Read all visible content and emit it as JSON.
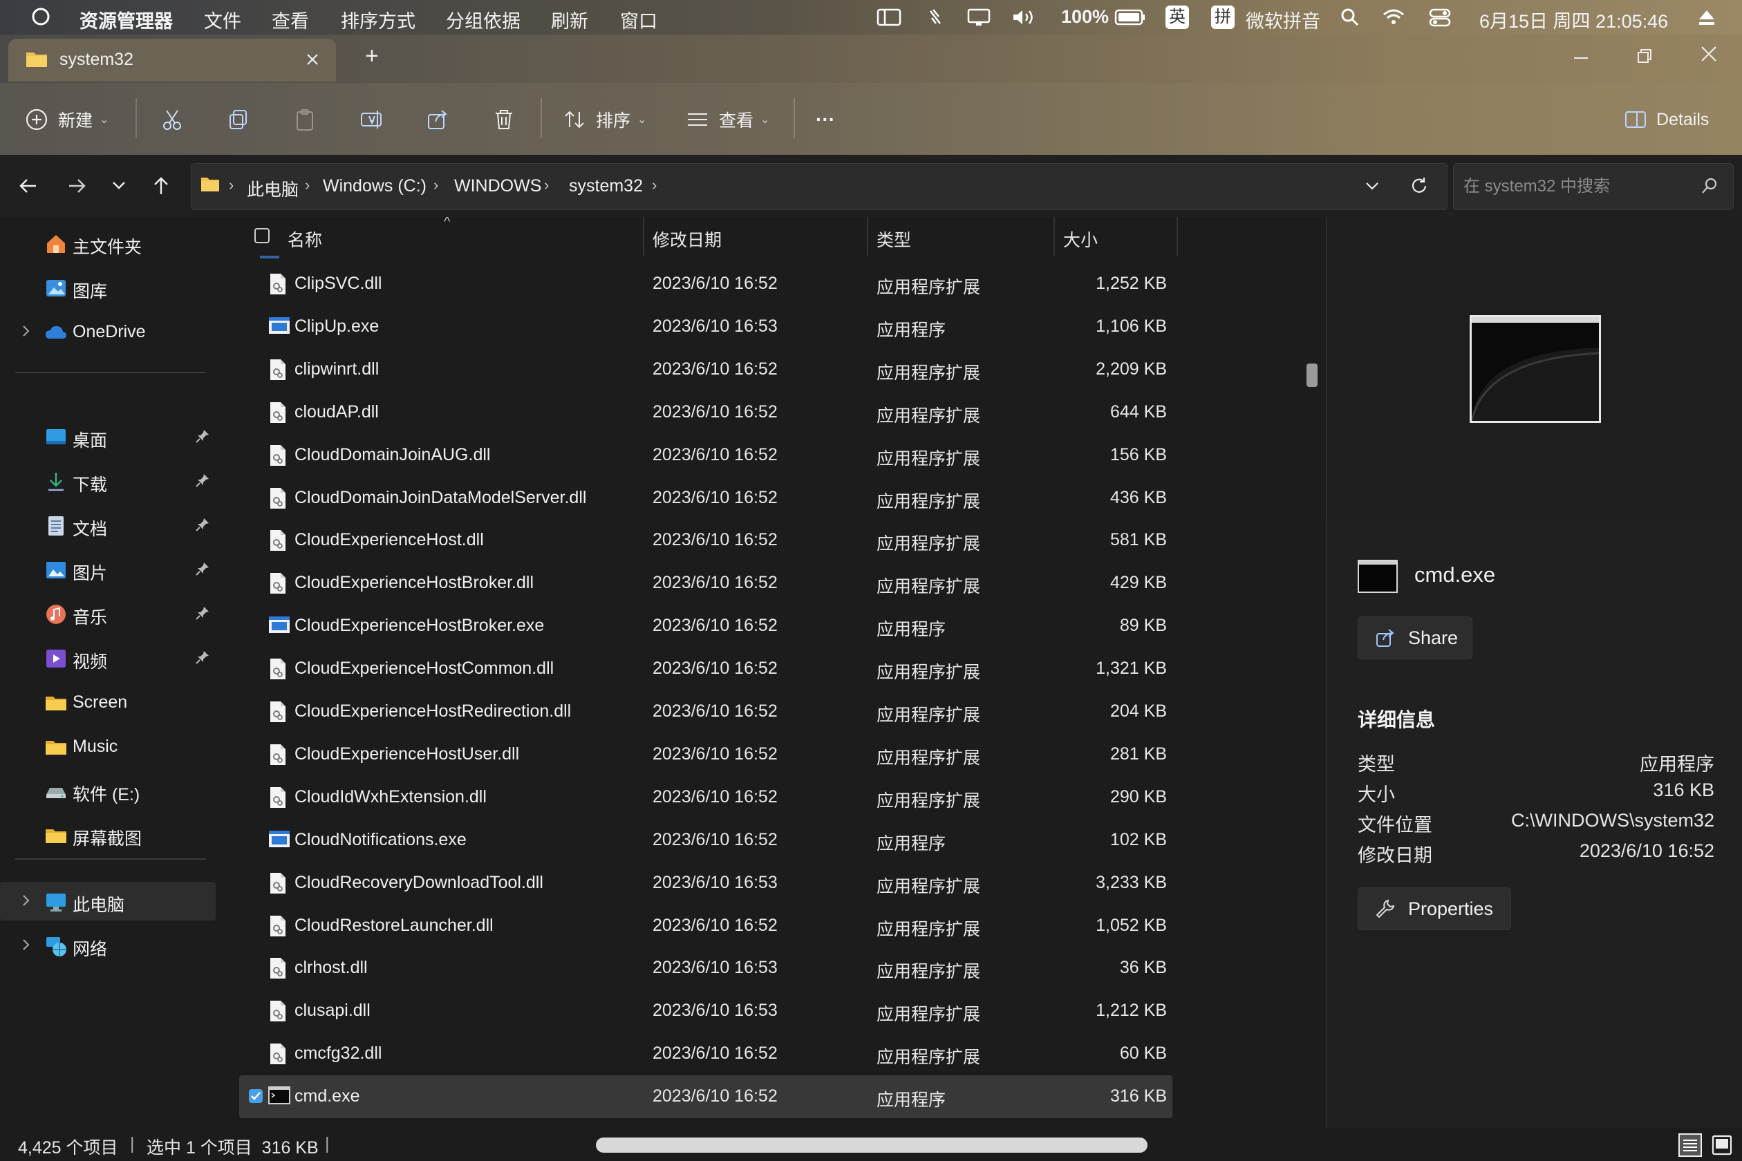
{
  "menubar": {
    "app_name": "资源管理器",
    "menus": [
      "文件",
      "查看",
      "排序方式",
      "分组依据",
      "刷新",
      "窗口"
    ],
    "battery": "100%",
    "ime_en": "英",
    "ime_pin": "拼",
    "ime_name": "微软拼音",
    "datetime": "6月15日 周四 21:05:46"
  },
  "tab": {
    "title": "system32",
    "new_tab": "+"
  },
  "toolbar": {
    "new_label": "新建",
    "sort_label": "排序",
    "view_label": "查看",
    "more_label": "···",
    "details_label": "Details"
  },
  "address": {
    "crumbs": [
      "此电脑",
      "Windows (C:)",
      "WINDOWS",
      "system32"
    ],
    "search_placeholder": "在 system32 中搜索"
  },
  "nav": {
    "home": "主文件夹",
    "gallery": "图库",
    "onedrive": "OneDrive",
    "quick": [
      {
        "label": "桌面",
        "icon": "desktop-icon"
      },
      {
        "label": "下载",
        "icon": "download-icon"
      },
      {
        "label": "文档",
        "icon": "document-icon"
      },
      {
        "label": "图片",
        "icon": "pictures-icon"
      },
      {
        "label": "音乐",
        "icon": "music-icon"
      },
      {
        "label": "视频",
        "icon": "video-icon"
      },
      {
        "label": "Screen",
        "icon": "folder-icon"
      },
      {
        "label": "Music",
        "icon": "folder-icon"
      },
      {
        "label": "软件 (E:)",
        "icon": "drive-icon"
      },
      {
        "label": "屏幕截图",
        "icon": "folder-icon"
      }
    ],
    "this_pc": "此电脑",
    "network": "网络"
  },
  "columns": {
    "name": "名称",
    "date": "修改日期",
    "type": "类型",
    "size": "大小"
  },
  "files": [
    {
      "name": "ClipSVC.dll",
      "date": "2023/6/10 16:52",
      "type": "应用程序扩展",
      "size": "1,252 KB",
      "kind": "dll"
    },
    {
      "name": "ClipUp.exe",
      "date": "2023/6/10 16:53",
      "type": "应用程序",
      "size": "1,106 KB",
      "kind": "exe"
    },
    {
      "name": "clipwinrt.dll",
      "date": "2023/6/10 16:52",
      "type": "应用程序扩展",
      "size": "2,209 KB",
      "kind": "dll"
    },
    {
      "name": "cloudAP.dll",
      "date": "2023/6/10 16:52",
      "type": "应用程序扩展",
      "size": "644 KB",
      "kind": "dll"
    },
    {
      "name": "CloudDomainJoinAUG.dll",
      "date": "2023/6/10 16:52",
      "type": "应用程序扩展",
      "size": "156 KB",
      "kind": "dll"
    },
    {
      "name": "CloudDomainJoinDataModelServer.dll",
      "date": "2023/6/10 16:52",
      "type": "应用程序扩展",
      "size": "436 KB",
      "kind": "dll"
    },
    {
      "name": "CloudExperienceHost.dll",
      "date": "2023/6/10 16:52",
      "type": "应用程序扩展",
      "size": "581 KB",
      "kind": "dll"
    },
    {
      "name": "CloudExperienceHostBroker.dll",
      "date": "2023/6/10 16:52",
      "type": "应用程序扩展",
      "size": "429 KB",
      "kind": "dll"
    },
    {
      "name": "CloudExperienceHostBroker.exe",
      "date": "2023/6/10 16:52",
      "type": "应用程序",
      "size": "89 KB",
      "kind": "exe"
    },
    {
      "name": "CloudExperienceHostCommon.dll",
      "date": "2023/6/10 16:52",
      "type": "应用程序扩展",
      "size": "1,321 KB",
      "kind": "dll"
    },
    {
      "name": "CloudExperienceHostRedirection.dll",
      "date": "2023/6/10 16:52",
      "type": "应用程序扩展",
      "size": "204 KB",
      "kind": "dll"
    },
    {
      "name": "CloudExperienceHostUser.dll",
      "date": "2023/6/10 16:52",
      "type": "应用程序扩展",
      "size": "281 KB",
      "kind": "dll"
    },
    {
      "name": "CloudIdWxhExtension.dll",
      "date": "2023/6/10 16:52",
      "type": "应用程序扩展",
      "size": "290 KB",
      "kind": "dll"
    },
    {
      "name": "CloudNotifications.exe",
      "date": "2023/6/10 16:52",
      "type": "应用程序",
      "size": "102 KB",
      "kind": "exe"
    },
    {
      "name": "CloudRecoveryDownloadTool.dll",
      "date": "2023/6/10 16:53",
      "type": "应用程序扩展",
      "size": "3,233 KB",
      "kind": "dll"
    },
    {
      "name": "CloudRestoreLauncher.dll",
      "date": "2023/6/10 16:52",
      "type": "应用程序扩展",
      "size": "1,052 KB",
      "kind": "dll"
    },
    {
      "name": "clrhost.dll",
      "date": "2023/6/10 16:53",
      "type": "应用程序扩展",
      "size": "36 KB",
      "kind": "dll"
    },
    {
      "name": "clusapi.dll",
      "date": "2023/6/10 16:53",
      "type": "应用程序扩展",
      "size": "1,212 KB",
      "kind": "dll"
    },
    {
      "name": "cmcfg32.dll",
      "date": "2023/6/10 16:52",
      "type": "应用程序扩展",
      "size": "60 KB",
      "kind": "dll"
    },
    {
      "name": "cmd.exe",
      "date": "2023/6/10 16:52",
      "type": "应用程序",
      "size": "316 KB",
      "kind": "cmd",
      "selected": true
    }
  ],
  "details": {
    "file_name": "cmd.exe",
    "share_label": "Share",
    "section_title": "详细信息",
    "rows": [
      {
        "label": "类型",
        "value": "应用程序"
      },
      {
        "label": "大小",
        "value": "316 KB"
      },
      {
        "label": "文件位置",
        "value": "C:\\WINDOWS\\system32"
      },
      {
        "label": "修改日期",
        "value": "2023/6/10 16:52"
      }
    ],
    "properties_label": "Properties"
  },
  "status": {
    "item_count": "4,425 个项目",
    "selected": "选中 1 个项目  316 KB"
  },
  "colors": {
    "accent": "#4aa0e6",
    "folder": "#f2c14e",
    "background": "#1c1c1c"
  }
}
